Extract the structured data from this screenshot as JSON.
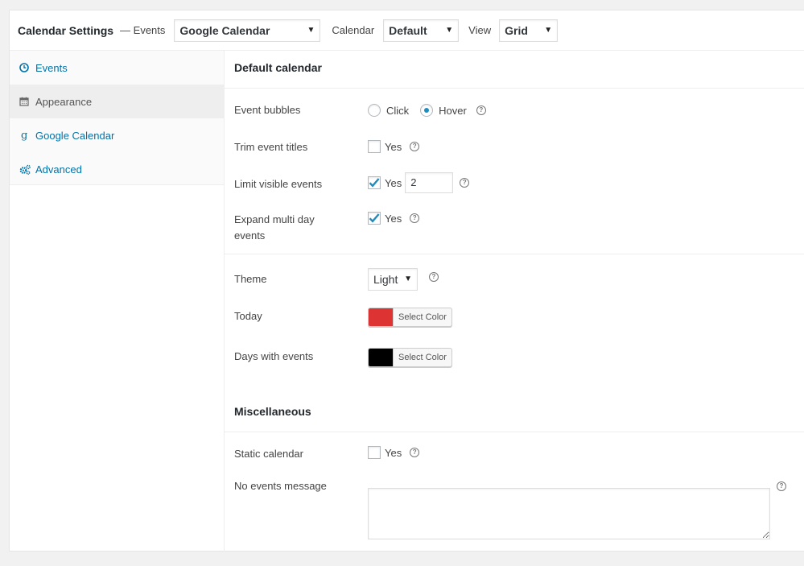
{
  "header": {
    "title": "Calendar Settings",
    "separator": "— Events",
    "events_select": "Google Calendar",
    "calendar_label": "Calendar",
    "calendar_select": "Default",
    "view_label": "View",
    "view_select": "Grid"
  },
  "sidebar": {
    "items": [
      {
        "label": "Events",
        "icon": "clock-icon"
      },
      {
        "label": "Appearance",
        "icon": "calendar-icon",
        "active": true
      },
      {
        "label": "Google Calendar",
        "icon": "google-icon"
      },
      {
        "label": "Advanced",
        "icon": "gears-icon"
      }
    ]
  },
  "sections": {
    "default_calendar": "Default calendar",
    "miscellaneous": "Miscellaneous"
  },
  "settings": {
    "event_bubbles": {
      "label": "Event bubbles",
      "opt_click": "Click",
      "opt_hover": "Hover",
      "selected": "Hover"
    },
    "trim_titles": {
      "label": "Trim event titles",
      "yes": "Yes",
      "checked": false
    },
    "limit_visible": {
      "label": "Limit visible events",
      "yes": "Yes",
      "checked": true,
      "value": "2"
    },
    "expand_multi": {
      "label": "Expand multi day events",
      "yes": "Yes",
      "checked": true
    },
    "theme": {
      "label": "Theme",
      "value": "Light"
    },
    "today": {
      "label": "Today",
      "button": "Select Color",
      "color": "#dd3333"
    },
    "days_with_events": {
      "label": "Days with events",
      "button": "Select Color",
      "color": "#000000"
    },
    "static_calendar": {
      "label": "Static calendar",
      "yes": "Yes",
      "checked": false
    },
    "no_events_message": {
      "label": "No events message",
      "value": ""
    }
  },
  "colors": {
    "accent": "#0073aa",
    "radio_dot": "#1e8cbe"
  }
}
